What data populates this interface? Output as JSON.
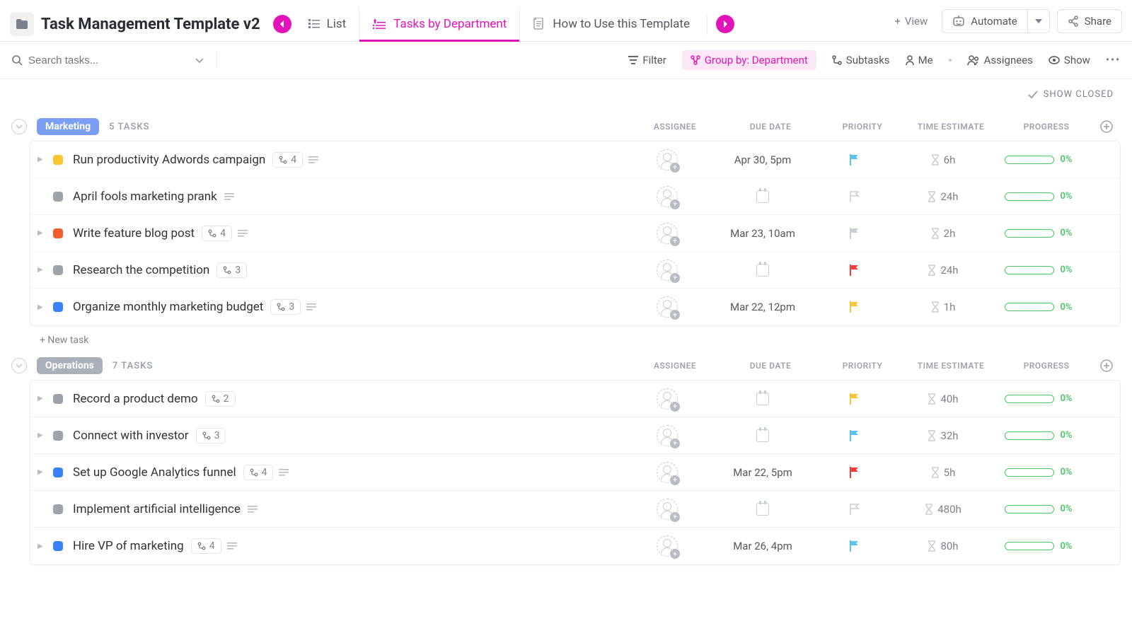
{
  "header": {
    "title": "Task Management Template v2",
    "tabs": [
      {
        "label": "List",
        "active": false,
        "icon": "list"
      },
      {
        "label": "Tasks by Department",
        "active": true,
        "icon": "list-pinned"
      },
      {
        "label": "How to Use this Template",
        "active": false,
        "icon": "doc"
      }
    ],
    "viewBtn": "View",
    "automate": "Automate",
    "share": "Share"
  },
  "toolbar": {
    "searchPlaceholder": "Search tasks...",
    "filter": "Filter",
    "groupBy": "Group by: Department",
    "subtasks": "Subtasks",
    "me": "Me",
    "assignees": "Assignees",
    "show": "Show"
  },
  "showClosed": "SHOW CLOSED",
  "columns": {
    "assignee": "ASSIGNEE",
    "due": "DUE DATE",
    "prio": "PRIORITY",
    "time": "TIME ESTIMATE",
    "prog": "PROGRESS"
  },
  "newTask": "+ New task",
  "groups": [
    {
      "name": "Marketing",
      "color": "#7b9ef5",
      "count": "5 TASKS",
      "tasks": [
        {
          "name": "Run productivity Adwords campaign",
          "status": "#f8c430",
          "expand": true,
          "subtasks": "4",
          "desc": true,
          "due": "Apr 30, 5pm",
          "flagColor": "#5bc3f0",
          "flagOutline": false,
          "time": "6h",
          "progress": "0%"
        },
        {
          "name": "April fools marketing prank",
          "status": "#9ea3ab",
          "expand": false,
          "subtasks": null,
          "desc": true,
          "due": null,
          "flagColor": "#c9cdd4",
          "flagOutline": true,
          "time": "24h",
          "progress": "0%"
        },
        {
          "name": "Write feature blog post",
          "status": "#f25c2e",
          "expand": true,
          "subtasks": "4",
          "desc": true,
          "due": "Mar 23, 10am",
          "flagColor": "#c9cdd4",
          "flagOutline": false,
          "time": "2h",
          "progress": "0%"
        },
        {
          "name": "Research the competition",
          "status": "#9ea3ab",
          "expand": true,
          "subtasks": "3",
          "desc": false,
          "due": null,
          "flagColor": "#f23b3b",
          "flagOutline": false,
          "time": "24h",
          "progress": "0%"
        },
        {
          "name": "Organize monthly marketing budget",
          "status": "#3b82f6",
          "expand": true,
          "subtasks": "3",
          "desc": true,
          "due": "Mar 22, 12pm",
          "flagColor": "#f8c430",
          "flagOutline": false,
          "time": "1h",
          "progress": "0%"
        }
      ]
    },
    {
      "name": "Operations",
      "color": "#aab0ba",
      "count": "7 TASKS",
      "tasks": [
        {
          "name": "Record a product demo",
          "status": "#9ea3ab",
          "expand": true,
          "subtasks": "2",
          "desc": false,
          "due": null,
          "flagColor": "#f8c430",
          "flagOutline": false,
          "time": "40h",
          "progress": "0%"
        },
        {
          "name": "Connect with investor",
          "status": "#9ea3ab",
          "expand": true,
          "subtasks": "3",
          "desc": false,
          "due": null,
          "flagColor": "#5bc3f0",
          "flagOutline": false,
          "time": "32h",
          "progress": "0%"
        },
        {
          "name": "Set up Google Analytics funnel",
          "status": "#3b82f6",
          "expand": true,
          "subtasks": "4",
          "desc": true,
          "due": "Mar 22, 5pm",
          "flagColor": "#f23b3b",
          "flagOutline": false,
          "time": "5h",
          "progress": "0%"
        },
        {
          "name": "Implement artificial intelligence",
          "status": "#9ea3ab",
          "expand": false,
          "subtasks": null,
          "desc": true,
          "due": null,
          "flagColor": "#c9cdd4",
          "flagOutline": true,
          "time": "480h",
          "progress": "0%"
        },
        {
          "name": "Hire VP of marketing",
          "status": "#3b82f6",
          "expand": true,
          "subtasks": "4",
          "desc": true,
          "due": "Mar 26, 4pm",
          "flagColor": "#5bc3f0",
          "flagOutline": false,
          "time": "80h",
          "progress": "0%"
        }
      ]
    }
  ]
}
